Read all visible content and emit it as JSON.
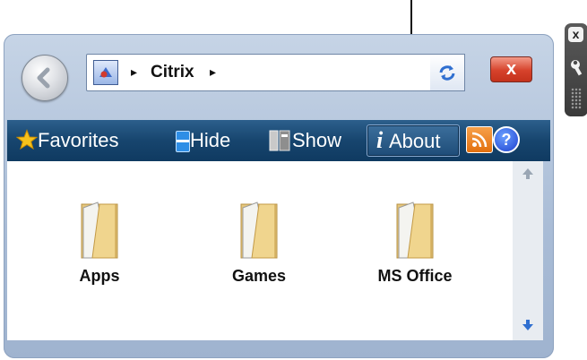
{
  "address_bar": {
    "breadcrumb": "Citrix",
    "separator": "▸"
  },
  "window_controls": {
    "close_label": "x"
  },
  "toolbar": {
    "favorites_label": "Favorites",
    "hide_label": "Hide",
    "show_label": "Show",
    "about_icon_text": "i",
    "about_label": "About",
    "help_label": "?"
  },
  "folders": [
    {
      "label": "Apps"
    },
    {
      "label": "Games"
    },
    {
      "label": "MS Office"
    }
  ],
  "side_toolbar": {
    "close_label": "x"
  },
  "colors": {
    "toolbar_bg": "#17456e",
    "window_bg": "#b4c5dc",
    "close_red": "#d6422b",
    "rss_orange": "#e2700f",
    "help_blue": "#1c3fcf",
    "folder_tan": "#e6c77c"
  },
  "icons": {
    "back": "back-arrow-icon",
    "address": "folder-location-icon",
    "refresh": "refresh-icon",
    "favorites": "star-icon",
    "hide": "hide-icon",
    "show": "show-icon",
    "about": "info-icon",
    "rss": "rss-icon",
    "help": "help-icon",
    "scroll_up": "arrow-up-icon",
    "scroll_down": "arrow-down-icon",
    "wrench": "wrench-icon",
    "grip": "grip-icon"
  }
}
